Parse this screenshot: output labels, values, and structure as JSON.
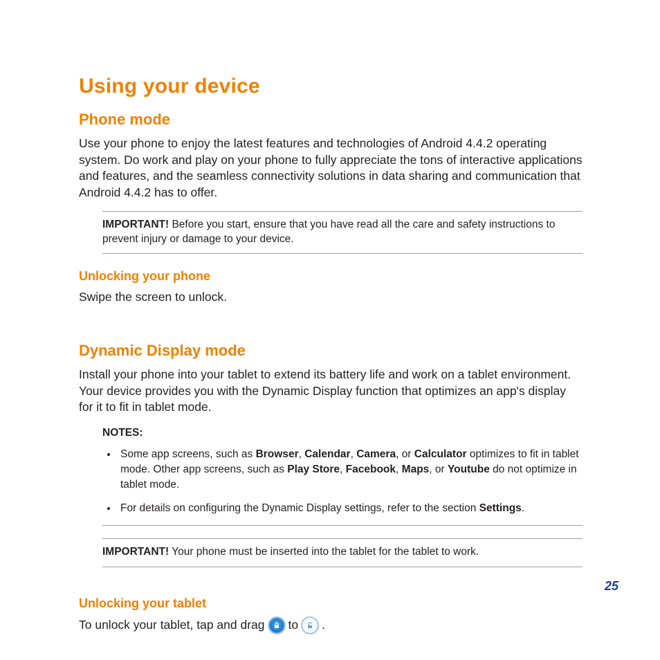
{
  "title": "Using your device",
  "s1": {
    "heading": "Phone mode",
    "para": "Use your phone to enjoy the latest features and technologies of Android 4.4.2 operating system. Do work and play on your phone to fully appreciate the tons of interactive applications and features, and the seamless connectivity solutions in data sharing and communication that Android 4.4.2 has to offer.",
    "important_label": "IMPORTANT!",
    "important_text": "  Before you start, ensure that you have read all the care and safety instructions to prevent injury or damage to your device.",
    "sub_heading": "Unlocking your phone",
    "sub_text": "Swipe the screen to unlock."
  },
  "s2": {
    "heading": "Dynamic Display mode",
    "para": "Install your phone into your tablet to extend its battery life and work on a tablet environment. Your device provides you with the Dynamic Display function that optimizes an app's display for it to fit in tablet mode.",
    "notes_label": "NOTES:",
    "note1_a": "Some app screens, such as  ",
    "note1_b1": "Browser",
    "note1_b2": "Calendar",
    "note1_b3": "Camera",
    "note1_b4": "Calculator",
    "note1_c": " optimizes to fit in tablet mode. Other app screens, such as ",
    "note1_d1": "Play Store",
    "note1_d2": "Facebook",
    "note1_d3": "Maps",
    "note1_d4": "Youtube",
    "note1_e": " do not optimize in tablet mode.",
    "note2_a": "For details on configuring the Dynamic Display settings, refer to the section ",
    "note2_b": "Settings",
    "note2_c": ".",
    "important_label": "IMPORTANT!",
    "important_text": "  Your phone must be inserted into the tablet for the tablet to work.",
    "sub_heading": "Unlocking your tablet",
    "inline_a": "To unlock your tablet, tap and drag ",
    "inline_b": " to ",
    "inline_c": " ."
  },
  "page_number": "25"
}
